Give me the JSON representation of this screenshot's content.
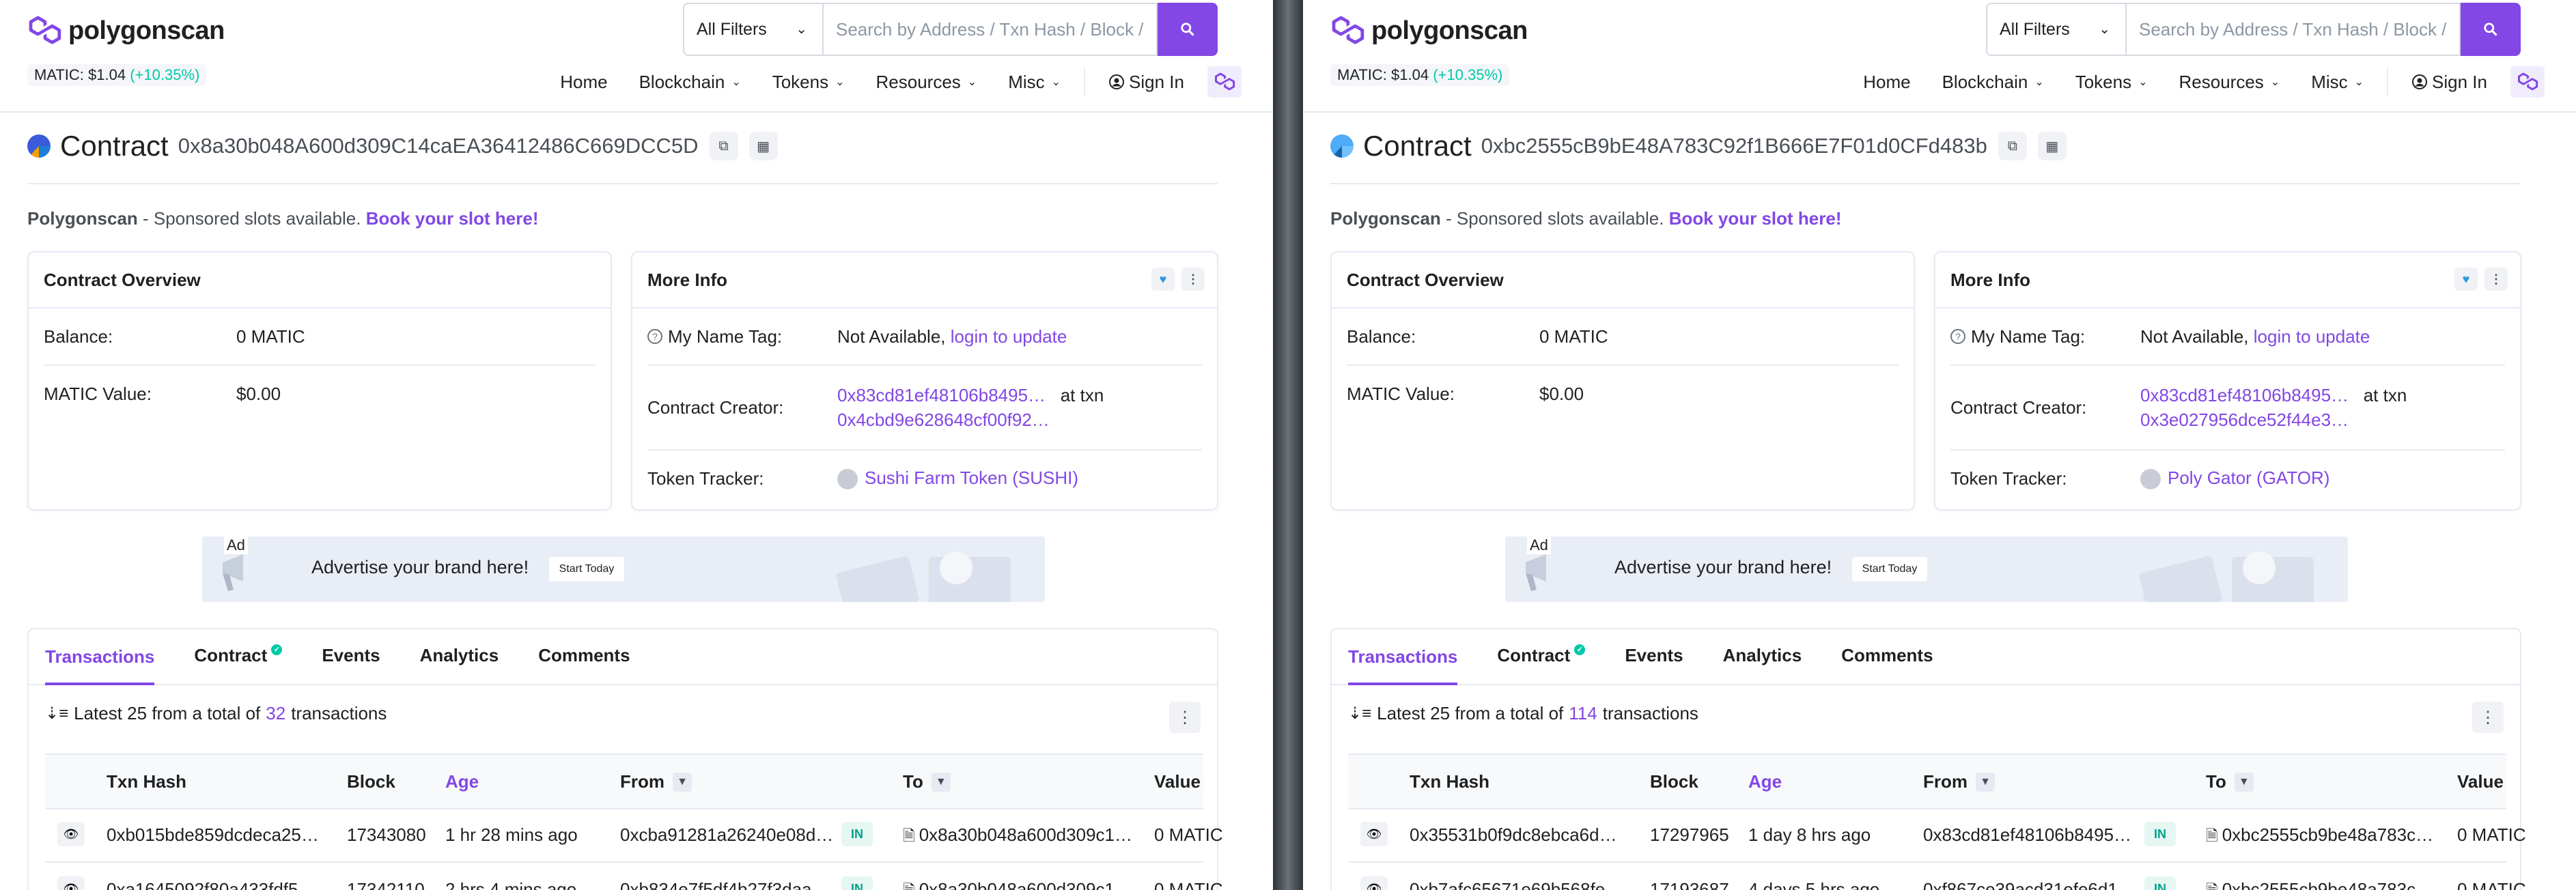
{
  "brand": {
    "name": "polygonscan",
    "accent": "#8247e5"
  },
  "price": {
    "label": "MATIC: $1.04",
    "change": "(+10.35%)"
  },
  "search": {
    "filter_label": "All Filters",
    "placeholder": "Search by Address / Txn Hash / Block / Token / Ens"
  },
  "nav": {
    "home": "Home",
    "blockchain": "Blockchain",
    "tokens": "Tokens",
    "resources": "Resources",
    "misc": "Misc",
    "signin": "Sign In"
  },
  "sponsor": {
    "brand": "Polygonscan",
    "text": " - Sponsored slots available. ",
    "link": "Book your slot here!"
  },
  "ad": {
    "tag": "Ad",
    "text": "Advertise your brand here!",
    "button": "Start Today"
  },
  "panes": [
    {
      "title_label": "Contract",
      "address": "0x8a30b048A600d309C14caEA36412486C669DCC5D",
      "overview": {
        "title": "Contract Overview",
        "balance_label": "Balance:",
        "balance_value": "0 MATIC",
        "value_label": "MATIC Value:",
        "value_value": "$0.00"
      },
      "more": {
        "title": "More Info",
        "name_tag_label": "My Name Tag:",
        "name_tag_value": "Not Available, ",
        "name_tag_link": "login to update",
        "creator_label": "Contract Creator:",
        "creator_addr": "0x83cd81ef48106b8495…",
        "creator_at": "at txn",
        "creator_txn": "0x4cbd9e628648cf00f92…",
        "tracker_label": "Token Tracker:",
        "tracker_value": "Sushi Farm Token (SUSHI)"
      },
      "tabs": [
        "Transactions",
        "Contract",
        "Events",
        "Analytics",
        "Comments"
      ],
      "summary": {
        "prefix": "Latest 25 from a total of",
        "count": "32",
        "suffix": "transactions"
      },
      "columns": [
        "Txn Hash",
        "Block",
        "Age",
        "From",
        "To",
        "Value"
      ],
      "rows": [
        {
          "hash": "0xb015bde859dcdeca25…",
          "block": "17343080",
          "age": "1 hr 28 mins ago",
          "from": "0xcba91281a26240e08d…",
          "dir": "IN",
          "to": "0x8a30b048a600d309c1…",
          "value": "0 MATIC"
        },
        {
          "hash": "0xa1645092f80a433fdf5…",
          "block": "17342110",
          "age": "2 hrs 4 mins ago",
          "from": "0xb834e7f5df4b27f3daa…",
          "dir": "IN",
          "to": "0x8a30b048a600d309c1…",
          "value": "0 MATIC"
        }
      ]
    },
    {
      "title_label": "Contract",
      "address": "0xbc2555cB9bE48A783C92f1B666E7F01d0CFd483b",
      "overview": {
        "title": "Contract Overview",
        "balance_label": "Balance:",
        "balance_value": "0 MATIC",
        "value_label": "MATIC Value:",
        "value_value": "$0.00"
      },
      "more": {
        "title": "More Info",
        "name_tag_label": "My Name Tag:",
        "name_tag_value": "Not Available, ",
        "name_tag_link": "login to update",
        "creator_label": "Contract Creator:",
        "creator_addr": "0x83cd81ef48106b8495…",
        "creator_at": "at txn",
        "creator_txn": "0x3e027956dce52f44e3…",
        "tracker_label": "Token Tracker:",
        "tracker_value": "Poly Gator (GATOR)"
      },
      "tabs": [
        "Transactions",
        "Contract",
        "Events",
        "Analytics",
        "Comments"
      ],
      "summary": {
        "prefix": "Latest 25 from a total of",
        "count": "114",
        "suffix": "transactions"
      },
      "columns": [
        "Txn Hash",
        "Block",
        "Age",
        "From",
        "To",
        "Value"
      ],
      "rows": [
        {
          "hash": "0x35531b0f9dc8ebca6d…",
          "block": "17297965",
          "age": "1 day 8 hrs ago",
          "from": "0x83cd81ef48106b8495…",
          "dir": "IN",
          "to": "0xbc2555cb9be48a783c…",
          "value": "0 MATIC"
        },
        {
          "hash": "0xb7afc65671e69b568fe…",
          "block": "17193687",
          "age": "4 days 5 hrs ago",
          "from": "0xf867ce39acd31efe6d1…",
          "dir": "IN",
          "to": "0xbc2555cb9be48a783c…",
          "value": "0 MATIC"
        }
      ]
    }
  ]
}
